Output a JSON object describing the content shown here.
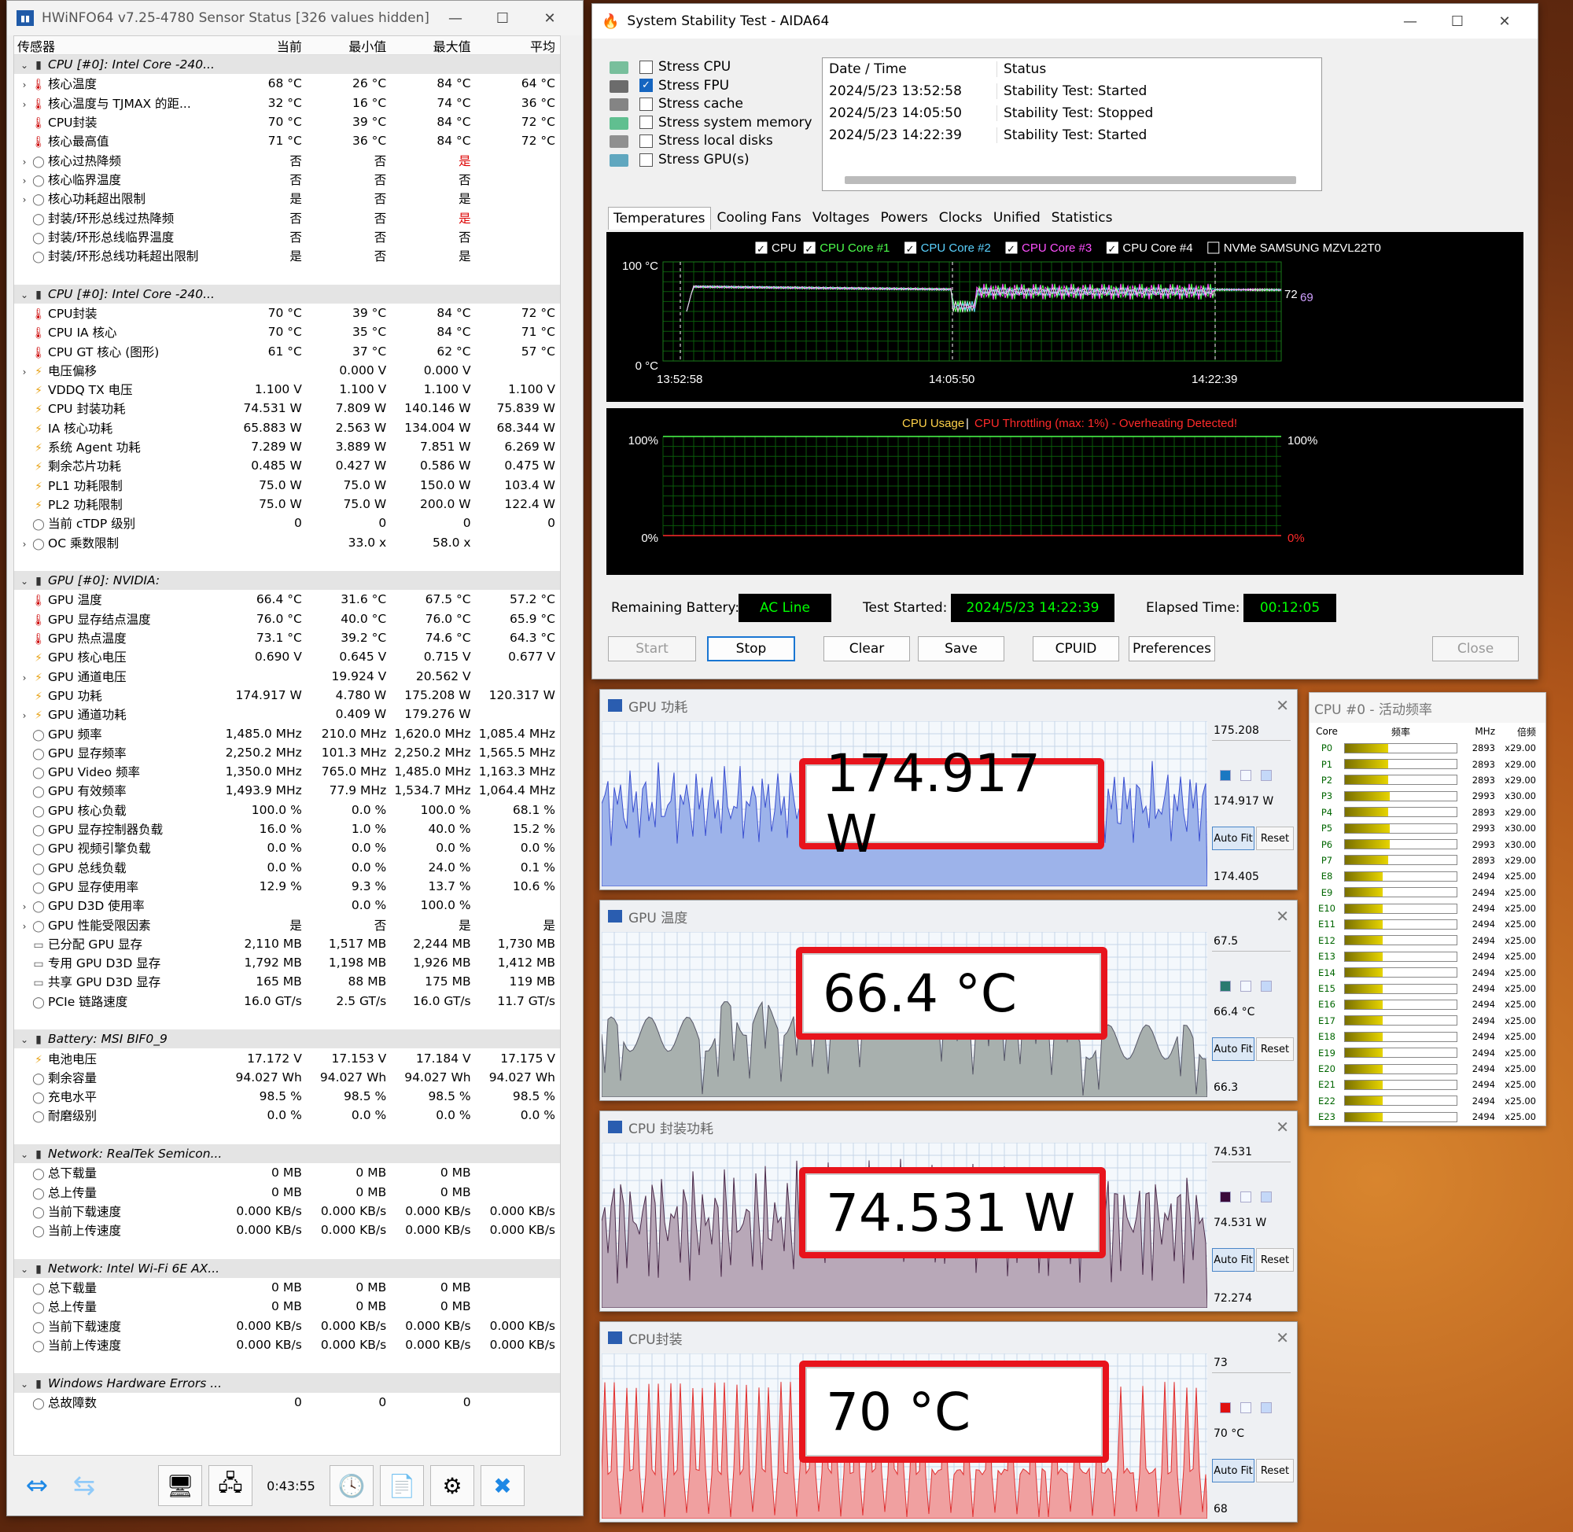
{
  "hwinfo": {
    "title": "HWiNFO64 v7.25-4780 Sensor Status [326 values hidden]",
    "cols": [
      "传感器",
      "当前",
      "最小值",
      "最大值",
      "平均"
    ],
    "rows": [
      {
        "t": "sec",
        "n": "CPU [#0]: Intel Core -240..."
      },
      {
        "e": ">",
        "i": "th",
        "n": "核心温度",
        "v": [
          "68 °C",
          "26 °C",
          "84 °C",
          "64 °C"
        ]
      },
      {
        "e": ">",
        "i": "th",
        "n": "核心温度与 TJMAX 的距...",
        "v": [
          "32 °C",
          "16 °C",
          "74 °C",
          "36 °C"
        ]
      },
      {
        "e": "",
        "i": "th",
        "n": "CPU封装",
        "v": [
          "70 °C",
          "39 °C",
          "84 °C",
          "72 °C"
        ]
      },
      {
        "e": "",
        "i": "th",
        "n": "核心最高值",
        "v": [
          "71 °C",
          "36 °C",
          "84 °C",
          "72 °C"
        ]
      },
      {
        "e": ">",
        "i": "ci",
        "n": "核心过热降频",
        "v": [
          "否",
          "否",
          "是",
          ""
        ],
        "r": 2
      },
      {
        "e": ">",
        "i": "ci",
        "n": "核心临界温度",
        "v": [
          "否",
          "否",
          "否",
          ""
        ]
      },
      {
        "e": ">",
        "i": "ci",
        "n": "核心功耗超出限制",
        "v": [
          "是",
          "否",
          "是",
          ""
        ]
      },
      {
        "e": "",
        "i": "ci",
        "n": "封装/环形总线过热降频",
        "v": [
          "否",
          "否",
          "是",
          ""
        ],
        "r": 2
      },
      {
        "e": "",
        "i": "ci",
        "n": "封装/环形总线临界温度",
        "v": [
          "否",
          "否",
          "否",
          ""
        ]
      },
      {
        "e": "",
        "i": "ci",
        "n": "封装/环形总线功耗超出限制",
        "v": [
          "是",
          "否",
          "是",
          ""
        ]
      },
      {
        "t": "blank"
      },
      {
        "t": "sec",
        "n": "CPU [#0]: Intel Core -240..."
      },
      {
        "e": "",
        "i": "th",
        "n": "CPU封装",
        "v": [
          "70 °C",
          "39 °C",
          "84 °C",
          "72 °C"
        ]
      },
      {
        "e": "",
        "i": "th",
        "n": "CPU IA 核心",
        "v": [
          "70 °C",
          "35 °C",
          "84 °C",
          "71 °C"
        ]
      },
      {
        "e": "",
        "i": "th",
        "n": "CPU GT 核心 (图形)",
        "v": [
          "61 °C",
          "37 °C",
          "62 °C",
          "57 °C"
        ]
      },
      {
        "e": ">",
        "i": "bo",
        "n": "电压偏移",
        "v": [
          "",
          "0.000 V",
          "0.000 V",
          ""
        ]
      },
      {
        "e": "",
        "i": "bo",
        "n": "VDDQ TX 电压",
        "v": [
          "1.100 V",
          "1.100 V",
          "1.100 V",
          "1.100 V"
        ]
      },
      {
        "e": "",
        "i": "bo",
        "n": "CPU 封装功耗",
        "v": [
          "74.531 W",
          "7.809 W",
          "140.146 W",
          "75.839 W"
        ]
      },
      {
        "e": "",
        "i": "bo",
        "n": "IA 核心功耗",
        "v": [
          "65.883 W",
          "2.563 W",
          "134.004 W",
          "68.344 W"
        ]
      },
      {
        "e": "",
        "i": "bo",
        "n": "系统 Agent 功耗",
        "v": [
          "7.289 W",
          "3.889 W",
          "7.851 W",
          "6.269 W"
        ]
      },
      {
        "e": "",
        "i": "bo",
        "n": "剩余芯片功耗",
        "v": [
          "0.485 W",
          "0.427 W",
          "0.586 W",
          "0.475 W"
        ]
      },
      {
        "e": "",
        "i": "bo",
        "n": "PL1 功耗限制",
        "v": [
          "75.0 W",
          "75.0 W",
          "150.0 W",
          "103.4 W"
        ]
      },
      {
        "e": "",
        "i": "bo",
        "n": "PL2 功耗限制",
        "v": [
          "75.0 W",
          "75.0 W",
          "200.0 W",
          "122.4 W"
        ]
      },
      {
        "e": "",
        "i": "ci",
        "n": "当前 cTDP 级别",
        "v": [
          "0",
          "0",
          "0",
          "0"
        ]
      },
      {
        "e": ">",
        "i": "ci",
        "n": "OC 乘数限制",
        "v": [
          "",
          "33.0 x",
          "58.0 x",
          ""
        ]
      },
      {
        "t": "blank"
      },
      {
        "t": "sec",
        "n": "GPU [#0]: NVIDIA:"
      },
      {
        "e": "",
        "i": "th",
        "n": "GPU 温度",
        "v": [
          "66.4 °C",
          "31.6 °C",
          "67.5 °C",
          "57.2 °C"
        ]
      },
      {
        "e": "",
        "i": "th",
        "n": "GPU 显存结点温度",
        "v": [
          "76.0 °C",
          "40.0 °C",
          "76.0 °C",
          "65.9 °C"
        ]
      },
      {
        "e": "",
        "i": "th",
        "n": "GPU 热点温度",
        "v": [
          "73.1 °C",
          "39.2 °C",
          "74.6 °C",
          "64.3 °C"
        ]
      },
      {
        "e": "",
        "i": "bo",
        "n": "GPU 核心电压",
        "v": [
          "0.690 V",
          "0.645 V",
          "0.715 V",
          "0.677 V"
        ]
      },
      {
        "e": ">",
        "i": "bo",
        "n": "GPU 通道电压",
        "v": [
          "",
          "19.924 V",
          "20.562 V",
          ""
        ]
      },
      {
        "e": "",
        "i": "bo",
        "n": "GPU 功耗",
        "v": [
          "174.917 W",
          "4.780 W",
          "175.208 W",
          "120.317 W"
        ]
      },
      {
        "e": ">",
        "i": "bo",
        "n": "GPU 通道功耗",
        "v": [
          "",
          "0.409 W",
          "179.276 W",
          ""
        ]
      },
      {
        "e": "",
        "i": "ci",
        "n": "GPU 频率",
        "v": [
          "1,485.0 MHz",
          "210.0 MHz",
          "1,620.0 MHz",
          "1,085.4 MHz"
        ]
      },
      {
        "e": "",
        "i": "ci",
        "n": "GPU 显存频率",
        "v": [
          "2,250.2 MHz",
          "101.3 MHz",
          "2,250.2 MHz",
          "1,565.5 MHz"
        ]
      },
      {
        "e": "",
        "i": "ci",
        "n": "GPU Video 频率",
        "v": [
          "1,350.0 MHz",
          "765.0 MHz",
          "1,485.0 MHz",
          "1,163.3 MHz"
        ]
      },
      {
        "e": "",
        "i": "ci",
        "n": "GPU 有效频率",
        "v": [
          "1,493.9 MHz",
          "77.9 MHz",
          "1,534.7 MHz",
          "1,064.4 MHz"
        ]
      },
      {
        "e": "",
        "i": "ci",
        "n": "GPU 核心负载",
        "v": [
          "100.0 %",
          "0.0 %",
          "100.0 %",
          "68.1 %"
        ]
      },
      {
        "e": "",
        "i": "ci",
        "n": "GPU 显存控制器负载",
        "v": [
          "16.0 %",
          "1.0 %",
          "40.0 %",
          "15.2 %"
        ]
      },
      {
        "e": "",
        "i": "ci",
        "n": "GPU 视频引擎负载",
        "v": [
          "0.0 %",
          "0.0 %",
          "0.0 %",
          "0.0 %"
        ]
      },
      {
        "e": "",
        "i": "ci",
        "n": "GPU 总线负载",
        "v": [
          "0.0 %",
          "0.0 %",
          "24.0 %",
          "0.1 %"
        ]
      },
      {
        "e": "",
        "i": "ci",
        "n": "GPU 显存使用率",
        "v": [
          "12.9 %",
          "9.3 %",
          "13.7 %",
          "10.6 %"
        ]
      },
      {
        "e": ">",
        "i": "ci",
        "n": "GPU D3D 使用率",
        "v": [
          "",
          "0.0 %",
          "100.0 %",
          ""
        ]
      },
      {
        "e": ">",
        "i": "ci",
        "n": "GPU 性能受限因素",
        "v": [
          "是",
          "否",
          "是",
          "是"
        ]
      },
      {
        "e": "",
        "i": "ch",
        "n": "已分配 GPU 显存",
        "v": [
          "2,110 MB",
          "1,517 MB",
          "2,244 MB",
          "1,730 MB"
        ]
      },
      {
        "e": "",
        "i": "ch",
        "n": "专用 GPU D3D 显存",
        "v": [
          "1,792 MB",
          "1,198 MB",
          "1,926 MB",
          "1,412 MB"
        ]
      },
      {
        "e": "",
        "i": "ch",
        "n": "共享 GPU D3D 显存",
        "v": [
          "165 MB",
          "88 MB",
          "175 MB",
          "119 MB"
        ]
      },
      {
        "e": "",
        "i": "ci",
        "n": "PCIe 链路速度",
        "v": [
          "16.0 GT/s",
          "2.5 GT/s",
          "16.0 GT/s",
          "11.7 GT/s"
        ]
      },
      {
        "t": "blank"
      },
      {
        "t": "sec",
        "n": "Battery: MSI BIF0_9"
      },
      {
        "e": "",
        "i": "bo",
        "n": "电池电压",
        "v": [
          "17.172 V",
          "17.153 V",
          "17.184 V",
          "17.175 V"
        ]
      },
      {
        "e": "",
        "i": "ci",
        "n": "剩余容量",
        "v": [
          "94.027 Wh",
          "94.027 Wh",
          "94.027 Wh",
          "94.027 Wh"
        ]
      },
      {
        "e": "",
        "i": "ci",
        "n": "充电水平",
        "v": [
          "98.5 %",
          "98.5 %",
          "98.5 %",
          "98.5 %"
        ]
      },
      {
        "e": "",
        "i": "ci",
        "n": "耐磨级别",
        "v": [
          "0.0 %",
          "0.0 %",
          "0.0 %",
          "0.0 %"
        ]
      },
      {
        "t": "blank"
      },
      {
        "t": "sec",
        "n": "Network: RealTek Semicon..."
      },
      {
        "e": "",
        "i": "ci",
        "n": "总下载量",
        "v": [
          "0 MB",
          "0 MB",
          "0 MB",
          ""
        ]
      },
      {
        "e": "",
        "i": "ci",
        "n": "总上传量",
        "v": [
          "0 MB",
          "0 MB",
          "0 MB",
          ""
        ]
      },
      {
        "e": "",
        "i": "ci",
        "n": "当前下载速度",
        "v": [
          "0.000 KB/s",
          "0.000 KB/s",
          "0.000 KB/s",
          "0.000 KB/s"
        ]
      },
      {
        "e": "",
        "i": "ci",
        "n": "当前上传速度",
        "v": [
          "0.000 KB/s",
          "0.000 KB/s",
          "0.000 KB/s",
          "0.000 KB/s"
        ]
      },
      {
        "t": "blank"
      },
      {
        "t": "sec",
        "n": "Network: Intel Wi-Fi 6E AX..."
      },
      {
        "e": "",
        "i": "ci",
        "n": "总下载量",
        "v": [
          "0 MB",
          "0 MB",
          "0 MB",
          ""
        ]
      },
      {
        "e": "",
        "i": "ci",
        "n": "总上传量",
        "v": [
          "0 MB",
          "0 MB",
          "0 MB",
          ""
        ]
      },
      {
        "e": "",
        "i": "ci",
        "n": "当前下载速度",
        "v": [
          "0.000 KB/s",
          "0.000 KB/s",
          "0.000 KB/s",
          "0.000 KB/s"
        ]
      },
      {
        "e": "",
        "i": "ci",
        "n": "当前上传速度",
        "v": [
          "0.000 KB/s",
          "0.000 KB/s",
          "0.000 KB/s",
          "0.000 KB/s"
        ]
      },
      {
        "t": "blank"
      },
      {
        "t": "sec",
        "n": "Windows Hardware Errors ..."
      },
      {
        "e": "",
        "i": "ci",
        "n": "总故障数",
        "v": [
          "0",
          "0",
          "0",
          ""
        ]
      }
    ],
    "elapsed": "0:43:55"
  },
  "aida": {
    "title": "System Stability Test - AIDA64",
    "stress": [
      {
        "label": "Stress CPU",
        "checked": false
      },
      {
        "label": "Stress FPU",
        "checked": true
      },
      {
        "label": "Stress cache",
        "checked": false
      },
      {
        "label": "Stress system memory",
        "checked": false
      },
      {
        "label": "Stress local disks",
        "checked": false
      },
      {
        "label": "Stress GPU(s)",
        "checked": false
      }
    ],
    "log_headers": [
      "Date / Time",
      "Status"
    ],
    "log": [
      [
        "2024/5/23 13:52:58",
        "Stability Test: Started"
      ],
      [
        "2024/5/23 14:05:50",
        "Stability Test: Stopped"
      ],
      [
        "2024/5/23 14:22:39",
        "Stability Test: Started"
      ]
    ],
    "tabs": [
      "Temperatures",
      "Cooling Fans",
      "Voltages",
      "Powers",
      "Clocks",
      "Unified",
      "Statistics"
    ],
    "legend": [
      {
        "label": "CPU",
        "color": "#ffffff"
      },
      {
        "label": "CPU Core #1",
        "color": "#4cff4c"
      },
      {
        "label": "CPU Core #2",
        "color": "#5ad2ff"
      },
      {
        "label": "CPU Core #3",
        "color": "#ff50ff"
      },
      {
        "label": "CPU Core #4",
        "color": "#ffffff"
      },
      {
        "label": "NVMe SAMSUNG MZVL22T0",
        "color": "#ffffff",
        "unchecked": true
      }
    ],
    "temp_graph": {
      "ymax": "100 °C",
      "ymin": "0 °C",
      "x": [
        "13:52:58",
        "14:05:50",
        "14:22:39"
      ],
      "end1": "72",
      "end2": "69"
    },
    "usage_graph": {
      "title_a": "CPU Usage",
      "sep": "|",
      "title_b": "CPU Throttling (max: 1%) - Overheating Detected!",
      "ytop": "100%",
      "ybot": "0%"
    },
    "remaining_label": "Remaining Battery:",
    "remaining": "AC Line",
    "started_label": "Test Started:",
    "started": "2024/5/23 14:22:39",
    "elapsed_label": "Elapsed Time:",
    "elapsed": "00:12:05",
    "buttons": [
      "Start",
      "Stop",
      "Clear",
      "Save",
      "CPUID",
      "Preferences",
      "Close"
    ]
  },
  "monitors": [
    {
      "title": "GPU 功耗",
      "max": "175.208",
      "cur": "174.917 W",
      "min": "174.405",
      "big": "174.917 W",
      "fill": "#9db3ea",
      "line": "#3a4fd0",
      "sq": "#1a78c2"
    },
    {
      "title": "GPU 温度",
      "max": "67.5",
      "cur": "66.4 °C",
      "min": "66.3",
      "big": "66.4 °C",
      "fill": "#a8b0ae",
      "line": "#556",
      "sq": "#2a7a70"
    },
    {
      "title": "CPU 封装功耗",
      "max": "74.531",
      "cur": "74.531 W",
      "min": "72.274",
      "big": "74.531 W",
      "fill": "#b8a8b8",
      "line": "#4a2a4a",
      "sq": "#3a0a3a"
    },
    {
      "title": "CPU封装",
      "max": "73",
      "cur": "70 °C",
      "min": "68",
      "big": "70 °C",
      "fill": "#f0a0a0",
      "line": "#e03030",
      "sq": "#e01010"
    }
  ],
  "monitor_buttons": {
    "autofit": "Auto Fit",
    "reset": "Reset"
  },
  "freq": {
    "title": "CPU #0 - 活动频率",
    "headers": [
      "Core",
      "频率",
      "MHz",
      "倍频"
    ],
    "rows": [
      [
        "P0",
        "2893",
        "x29.00",
        0.39
      ],
      [
        "P1",
        "2893",
        "x29.00",
        0.39
      ],
      [
        "P2",
        "2893",
        "x29.00",
        0.39
      ],
      [
        "P3",
        "2993",
        "x30.00",
        0.4
      ],
      [
        "P4",
        "2893",
        "x29.00",
        0.39
      ],
      [
        "P5",
        "2993",
        "x30.00",
        0.4
      ],
      [
        "P6",
        "2993",
        "x30.00",
        0.4
      ],
      [
        "P7",
        "2893",
        "x29.00",
        0.39
      ],
      [
        "E8",
        "2494",
        "x25.00",
        0.34
      ],
      [
        "E9",
        "2494",
        "x25.00",
        0.34
      ],
      [
        "E10",
        "2494",
        "x25.00",
        0.34
      ],
      [
        "E11",
        "2494",
        "x25.00",
        0.34
      ],
      [
        "E12",
        "2494",
        "x25.00",
        0.34
      ],
      [
        "E13",
        "2494",
        "x25.00",
        0.34
      ],
      [
        "E14",
        "2494",
        "x25.00",
        0.34
      ],
      [
        "E15",
        "2494",
        "x25.00",
        0.34
      ],
      [
        "E16",
        "2494",
        "x25.00",
        0.34
      ],
      [
        "E17",
        "2494",
        "x25.00",
        0.34
      ],
      [
        "E18",
        "2494",
        "x25.00",
        0.34
      ],
      [
        "E19",
        "2494",
        "x25.00",
        0.34
      ],
      [
        "E20",
        "2494",
        "x25.00",
        0.34
      ],
      [
        "E21",
        "2494",
        "x25.00",
        0.34
      ],
      [
        "E22",
        "2494",
        "x25.00",
        0.34
      ],
      [
        "E23",
        "2494",
        "x25.00",
        0.34
      ]
    ]
  }
}
